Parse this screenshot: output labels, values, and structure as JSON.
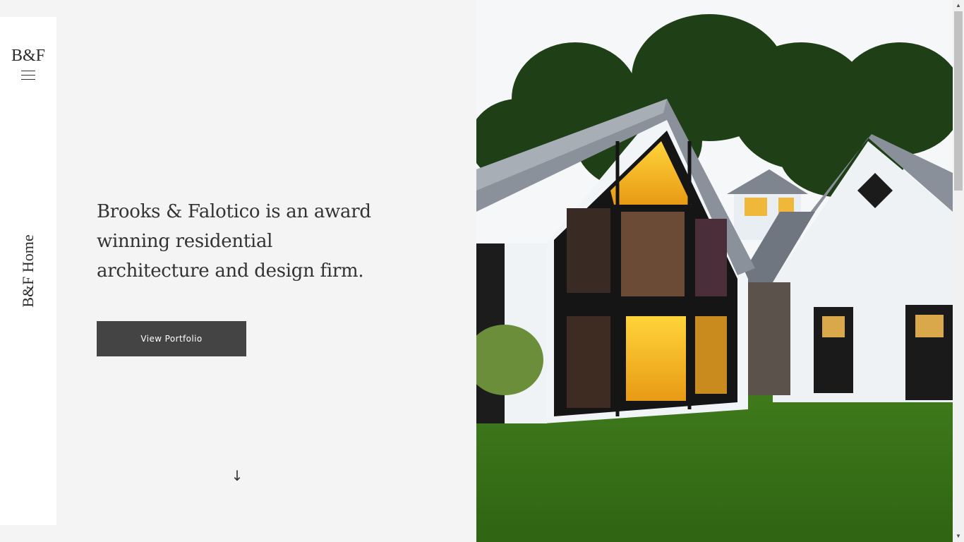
{
  "sidebar": {
    "logo": "B&F",
    "vertical_label": "B&F Home"
  },
  "hero": {
    "headline": "Brooks & Falotico is an award winning residential architecture and design firm.",
    "button_label": "View Portfolio",
    "image_description_icon": "house-photo"
  },
  "colors": {
    "background": "#f4f4f4",
    "sidebar": "#ffffff",
    "button": "#444444",
    "text": "#333333"
  }
}
